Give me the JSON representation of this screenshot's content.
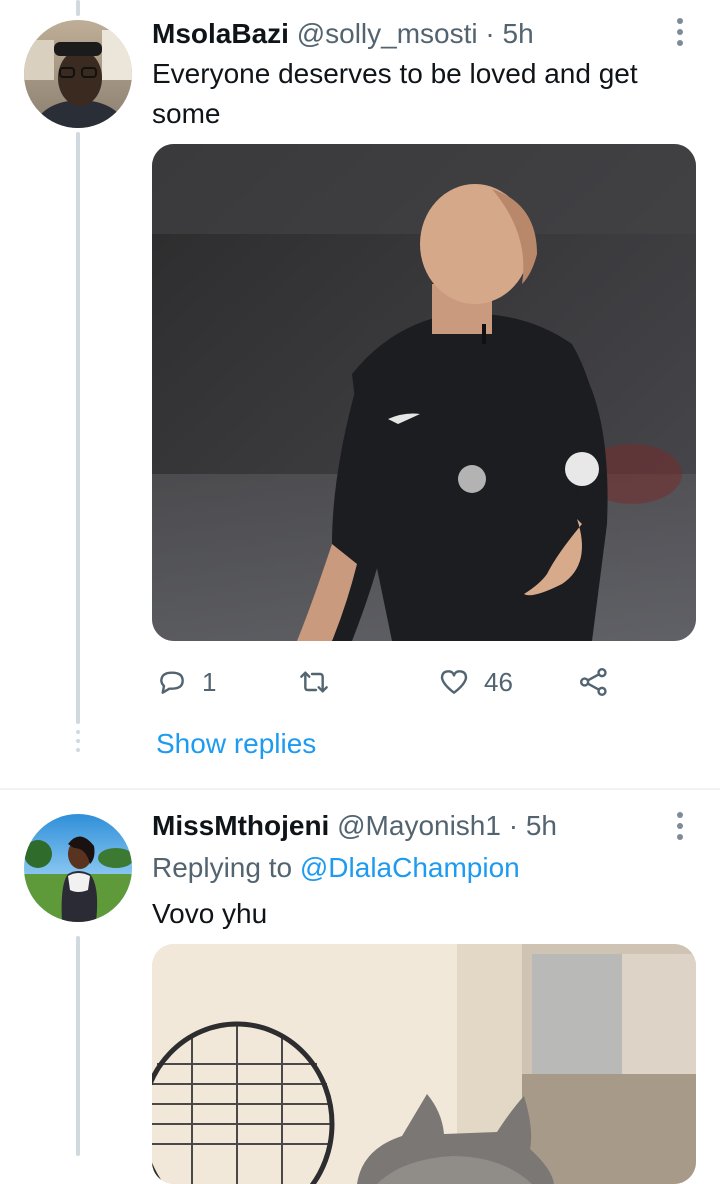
{
  "tweets": [
    {
      "display_name": "MsolaBazi",
      "handle": "@solly_msosti",
      "separator": "·",
      "time": "5h",
      "text": "Everyone deserves to be loved and get some",
      "media_label": "referee shrugging",
      "actions": {
        "reply_count": "1",
        "retweet_count": "",
        "like_count": "46"
      },
      "show_replies": "Show replies"
    },
    {
      "display_name": "MissMthojeni",
      "handle": "@Mayonish1",
      "separator": "·",
      "time": "5h",
      "replying_prefix": "Replying to",
      "replying_to": "@DlalaChampion",
      "text": "Vovo yhu",
      "media_label": "cat by fan"
    }
  ],
  "icons": {
    "more": "more-vertical-icon",
    "reply": "reply-icon",
    "retweet": "retweet-icon",
    "like": "heart-icon",
    "share": "share-icon"
  },
  "colors": {
    "accent": "#1d9bf0",
    "secondary_text": "#536471",
    "thread_line": "#cfd9de"
  }
}
